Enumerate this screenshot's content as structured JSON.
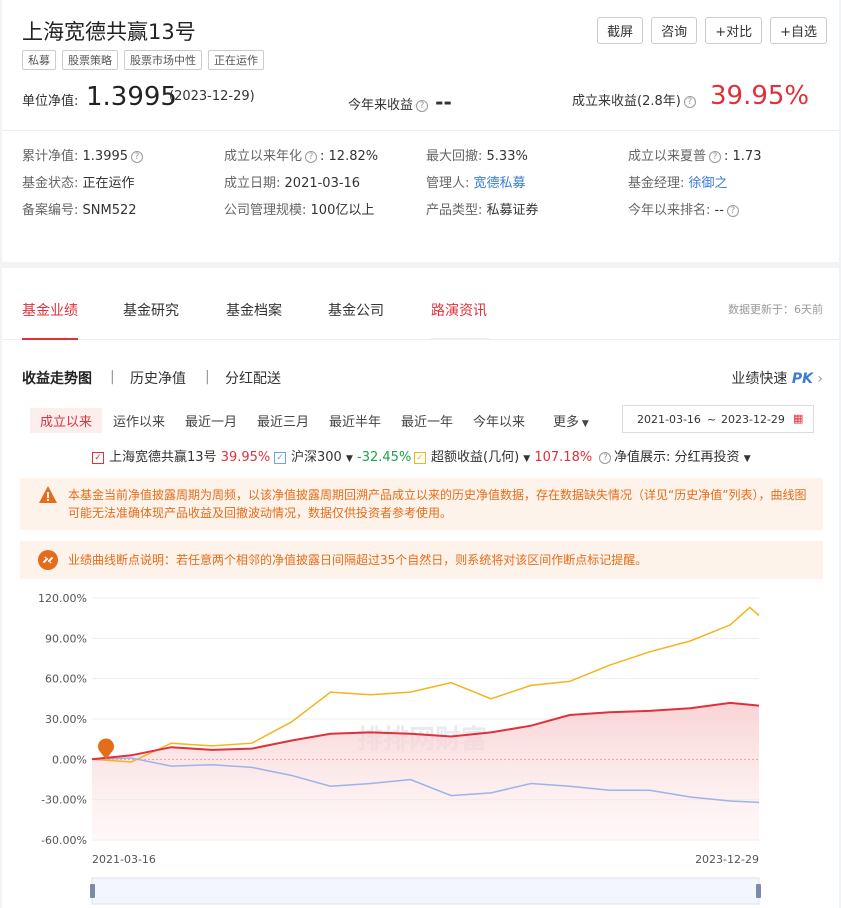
{
  "fund": {
    "title": "上海宽德共赢13号",
    "tags": [
      "私募",
      "股票策略",
      "股票市场中性",
      "正在运作"
    ],
    "buttons": [
      "截屏",
      "咨询",
      "+对比",
      "+自选"
    ],
    "nav_label": "单位净值:",
    "nav_value": "1.3995",
    "nav_date": "(2023-12-29)",
    "ytd_label": "今年来收益",
    "ytd_value": "--",
    "since_label": "成立来收益(2.8年)",
    "since_value": "39.95%"
  },
  "info": [
    [
      {
        "label": "累计净值:",
        "value": "1.3995",
        "help": true
      },
      {
        "label": "成立以来年化",
        "value": "12.82%",
        "help": true
      },
      {
        "label": "最大回撤:",
        "value": "5.33%"
      },
      {
        "label": "成立以来夏普",
        "value": "1.73",
        "help": true
      }
    ],
    [
      {
        "label": "基金状态:",
        "value": "正在运作"
      },
      {
        "label": "成立日期:",
        "value": "2021-03-16"
      },
      {
        "label": "管理人:",
        "value": "宽德私募",
        "link": true
      },
      {
        "label": "基金经理:",
        "value": "徐御之",
        "link": true
      }
    ],
    [
      {
        "label": "备案编号:",
        "value": "SNM522"
      },
      {
        "label": "公司管理规模:",
        "value": "100亿以上"
      },
      {
        "label": "产品类型:",
        "value": "私募证券"
      },
      {
        "label": "今年以来排名:",
        "value": "--",
        "help": true
      }
    ]
  ],
  "tabs": [
    "基金业绩",
    "基金研究",
    "基金档案",
    "基金公司",
    "路演资讯"
  ],
  "update_note": "数据更新于：6天前",
  "subtabs": [
    "收益走势图",
    "历史净值",
    "分红配送"
  ],
  "pk": {
    "label": "业绩快速",
    "brand": "PK"
  },
  "periods": [
    "成立以来",
    "运作以来",
    "最近一月",
    "最近三月",
    "最近半年",
    "最近一年",
    "今年以来",
    "更多"
  ],
  "date_range": {
    "start": "2021-03-16",
    "sep": "~",
    "end": "2023-12-29"
  },
  "legend": {
    "fund": {
      "name": "上海宽德共赢13号",
      "value": "39.95%"
    },
    "index": {
      "name": "沪深300",
      "value": "-32.45%"
    },
    "excess": {
      "name": "超额收益(几何)",
      "value": "107.18%"
    },
    "display_label": "净值展示:",
    "display_value": "分红再投资"
  },
  "notices": {
    "n1": "本基金当前净值披露周期为周频，以该净值披露周期回溯产品成立以来的历史净值数据，存在数据缺失情况（详见“历史净值”列表），曲线图可能无法准确体现产品收益及回撤波动情况，数据仅供投资者参考使用。",
    "n2": "业绩曲线断点说明：若任意两个相邻的净值披露日间隔超过35个自然日，则系统将对该区间作断点标记提醒。"
  },
  "colors": {
    "fund": "#e0303b",
    "index": "#9db3ea",
    "excess": "#f5b31c",
    "accent": "#e0303b"
  },
  "chart_data": {
    "type": "line",
    "y_ticks": [
      "120.00%",
      "90.00%",
      "60.00%",
      "30.00%",
      "0.00%",
      "-30.00%",
      "-60.00%"
    ],
    "ylim": [
      -60,
      120
    ],
    "x_start_label": "2021-03-16",
    "x_end_label": "2023-12-29",
    "x_range": [
      "2021-03-16",
      "2023-12-29"
    ],
    "series": [
      {
        "name": "上海宽德共赢13号",
        "x": [
          "2021-03-16",
          "2021-05-15",
          "2021-07-15",
          "2021-09-15",
          "2021-11-15",
          "2022-01-15",
          "2022-03-15",
          "2022-05-15",
          "2022-07-15",
          "2022-09-15",
          "2022-11-15",
          "2023-01-15",
          "2023-03-15",
          "2023-05-15",
          "2023-07-15",
          "2023-09-15",
          "2023-11-15",
          "2023-12-29"
        ],
        "y": [
          0,
          3,
          9,
          7,
          8,
          14,
          19,
          20,
          19,
          17,
          20,
          25,
          33,
          35,
          36,
          38,
          42,
          40
        ]
      },
      {
        "name": "沪深300",
        "x": [
          "2021-03-16",
          "2021-05-15",
          "2021-07-15",
          "2021-09-15",
          "2021-11-15",
          "2022-01-15",
          "2022-03-15",
          "2022-05-15",
          "2022-07-15",
          "2022-09-15",
          "2022-11-15",
          "2023-01-15",
          "2023-03-15",
          "2023-05-15",
          "2023-07-15",
          "2023-09-15",
          "2023-11-15",
          "2023-12-29"
        ],
        "y": [
          0,
          1,
          -5,
          -4,
          -6,
          -12,
          -20,
          -18,
          -15,
          -27,
          -25,
          -18,
          -20,
          -23,
          -23,
          -28,
          -31,
          -32
        ]
      },
      {
        "name": "超额收益(几何)",
        "x": [
          "2021-03-16",
          "2021-05-15",
          "2021-07-15",
          "2021-09-15",
          "2021-11-15",
          "2022-01-15",
          "2022-03-15",
          "2022-05-15",
          "2022-07-15",
          "2022-09-15",
          "2022-11-15",
          "2023-01-15",
          "2023-03-15",
          "2023-05-15",
          "2023-07-15",
          "2023-09-15",
          "2023-11-15",
          "2023-12-15",
          "2023-12-29"
        ],
        "y": [
          0,
          -2,
          12,
          10,
          12,
          28,
          50,
          48,
          50,
          57,
          45,
          55,
          58,
          70,
          80,
          88,
          100,
          113,
          107
        ]
      }
    ],
    "break_marker_date": "2021-03-16",
    "watermark": "排排网财富"
  }
}
